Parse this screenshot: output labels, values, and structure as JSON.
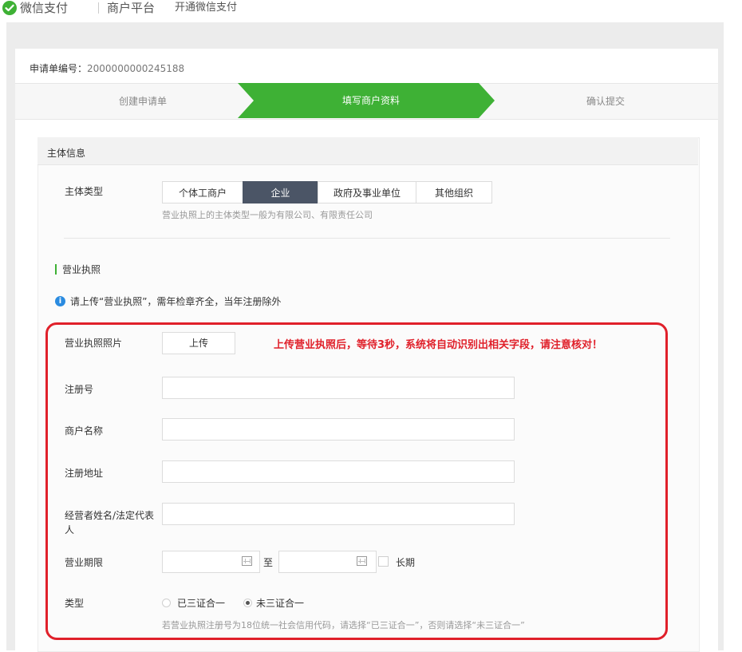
{
  "header": {
    "brand": "微信支付",
    "platform": "商户平台",
    "open_link": "开通微信支付"
  },
  "application": {
    "label": "申请单编号：",
    "number": "2000000000245188"
  },
  "steps": [
    {
      "label": "创建申请单",
      "state": "done"
    },
    {
      "label": "填写商户资料",
      "state": "active"
    },
    {
      "label": "确认提交",
      "state": "pending"
    }
  ],
  "section": {
    "title": "主体信息",
    "entity_type": {
      "label": "主体类型",
      "options": [
        "个体工商户",
        "企业",
        "政府及事业单位",
        "其他组织"
      ],
      "selected": "企业",
      "hint": "营业执照上的主体类型一般为有限公司、有限责任公司"
    },
    "license": {
      "title": "营业执照",
      "info": "请上传“营业执照”，需年检章齐全，当年注册除外",
      "photo_label": "营业执照照片",
      "upload_label": "上传",
      "annotation": "上传营业执照后，等待3秒，系统将自动识别出相关字段，请注意核对！",
      "reg_no_label": "注册号",
      "reg_no_value": "",
      "merchant_label": "商户名称",
      "merchant_value": "",
      "address_label": "注册地址",
      "address_value": "",
      "legal_label": "经营者姓名/法定代表人",
      "legal_value": "",
      "term_label": "营业期限",
      "term_start": "",
      "term_end": "",
      "to_text": "至",
      "long_term_label": "长期",
      "type_label": "类型",
      "type_options": [
        "已三证合一",
        "未三证合一"
      ],
      "type_selected": "未三证合一",
      "type_hint": "若营业执照注册号为18位统一社会信用代码，请选择“已三证合一”，否则请选择“未三证合一”"
    }
  },
  "colors": {
    "brand_green": "#3eb135",
    "selected_segment": "#4b5566",
    "annotation_red": "#e0202a",
    "info_blue": "#2a8be0"
  }
}
